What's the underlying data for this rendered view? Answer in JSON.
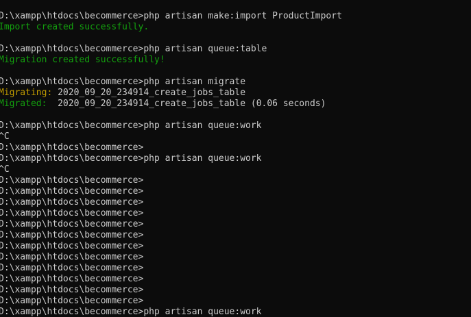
{
  "terminal": {
    "colors": {
      "background": "#0c0c0c",
      "default": "#cccccc",
      "green": "#13a10e",
      "yellow": "#c19c00"
    },
    "lines": [
      [
        {
          "text": "D:\\xampp\\htdocs\\becommerce>php artisan make:import ProductImport",
          "color": "default"
        }
      ],
      [
        {
          "text": "Import created successfully.",
          "color": "green"
        }
      ],
      [],
      [
        {
          "text": "D:\\xampp\\htdocs\\becommerce>php artisan queue:table",
          "color": "default"
        }
      ],
      [
        {
          "text": "Migration created successfully!",
          "color": "green"
        }
      ],
      [],
      [
        {
          "text": "D:\\xampp\\htdocs\\becommerce>php artisan migrate",
          "color": "default"
        }
      ],
      [
        {
          "text": "Migrating:",
          "color": "yellow"
        },
        {
          "text": " 2020_09_20_234914_create_jobs_table",
          "color": "default"
        }
      ],
      [
        {
          "text": "Migrated:",
          "color": "green"
        },
        {
          "text": "  2020_09_20_234914_create_jobs_table (0.06 seconds)",
          "color": "default"
        }
      ],
      [],
      [
        {
          "text": "D:\\xampp\\htdocs\\becommerce>php artisan queue:work",
          "color": "default"
        }
      ],
      [
        {
          "text": "^C",
          "color": "default"
        }
      ],
      [
        {
          "text": "D:\\xampp\\htdocs\\becommerce>",
          "color": "default"
        }
      ],
      [
        {
          "text": "D:\\xampp\\htdocs\\becommerce>php artisan queue:work",
          "color": "default"
        }
      ],
      [
        {
          "text": "^C",
          "color": "default"
        }
      ],
      [
        {
          "text": "D:\\xampp\\htdocs\\becommerce>",
          "color": "default"
        }
      ],
      [
        {
          "text": "D:\\xampp\\htdocs\\becommerce>",
          "color": "default"
        }
      ],
      [
        {
          "text": "D:\\xampp\\htdocs\\becommerce>",
          "color": "default"
        }
      ],
      [
        {
          "text": "D:\\xampp\\htdocs\\becommerce>",
          "color": "default"
        }
      ],
      [
        {
          "text": "D:\\xampp\\htdocs\\becommerce>",
          "color": "default"
        }
      ],
      [
        {
          "text": "D:\\xampp\\htdocs\\becommerce>",
          "color": "default"
        }
      ],
      [
        {
          "text": "D:\\xampp\\htdocs\\becommerce>",
          "color": "default"
        }
      ],
      [
        {
          "text": "D:\\xampp\\htdocs\\becommerce>",
          "color": "default"
        }
      ],
      [
        {
          "text": "D:\\xampp\\htdocs\\becommerce>",
          "color": "default"
        }
      ],
      [
        {
          "text": "D:\\xampp\\htdocs\\becommerce>",
          "color": "default"
        }
      ],
      [
        {
          "text": "D:\\xampp\\htdocs\\becommerce>",
          "color": "default"
        }
      ],
      [
        {
          "text": "D:\\xampp\\htdocs\\becommerce>",
          "color": "default"
        }
      ],
      [
        {
          "text": "D:\\xampp\\htdocs\\becommerce>php artisan queue:work",
          "color": "default"
        }
      ]
    ]
  }
}
